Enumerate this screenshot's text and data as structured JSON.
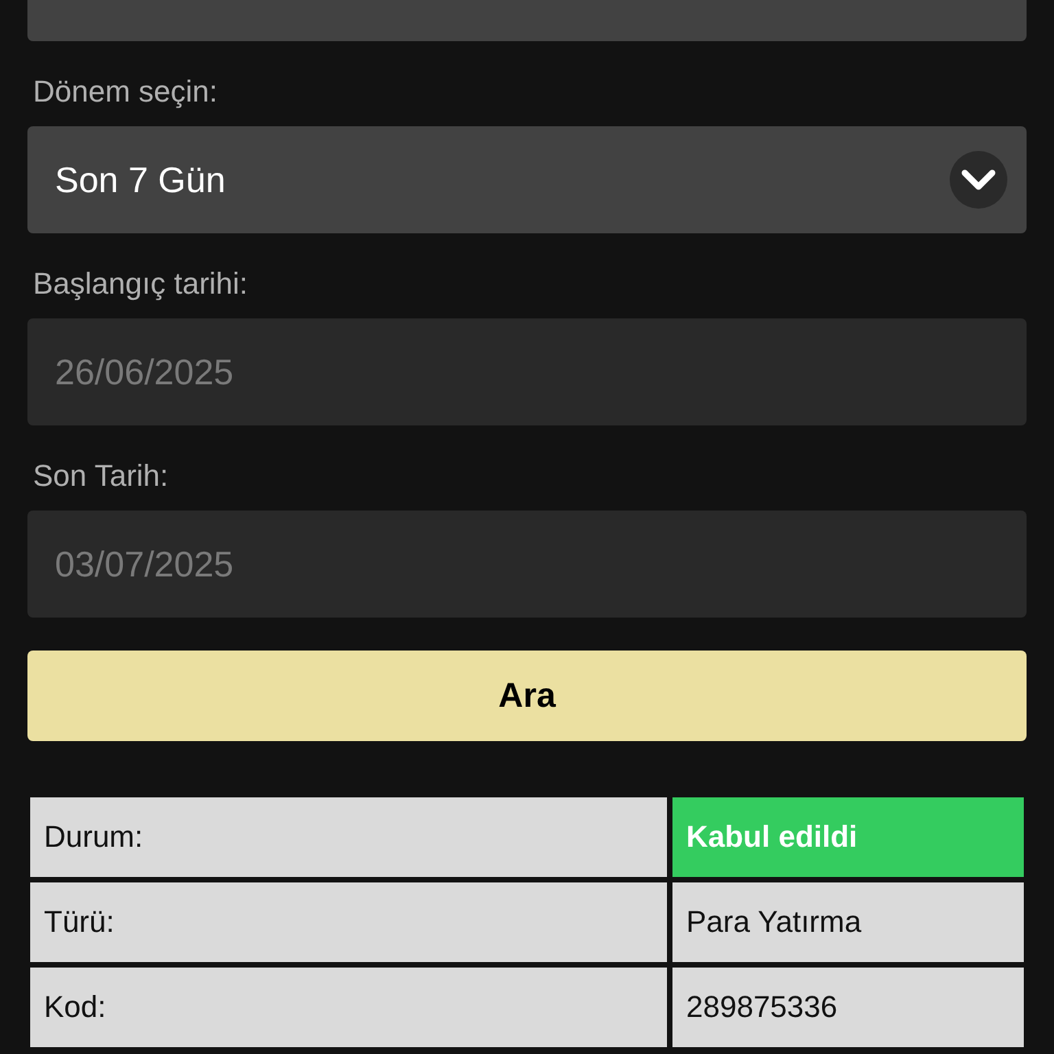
{
  "period": {
    "label": "Dönem seçin:",
    "value": "Son 7 Gün"
  },
  "start_date": {
    "label": "Başlangıç tarihi:",
    "placeholder": "26/06/2025"
  },
  "end_date": {
    "label": "Son Tarih:",
    "placeholder": "03/07/2025"
  },
  "search_button": "Ara",
  "details": [
    {
      "label": "Durum:",
      "value": "Kabul edildi",
      "kind": "status",
      "color": "#34cc5f"
    },
    {
      "label": "Türü:",
      "value": "Para Yatırma",
      "kind": "text"
    },
    {
      "label": "Kod:",
      "value": "289875336",
      "kind": "text"
    }
  ]
}
